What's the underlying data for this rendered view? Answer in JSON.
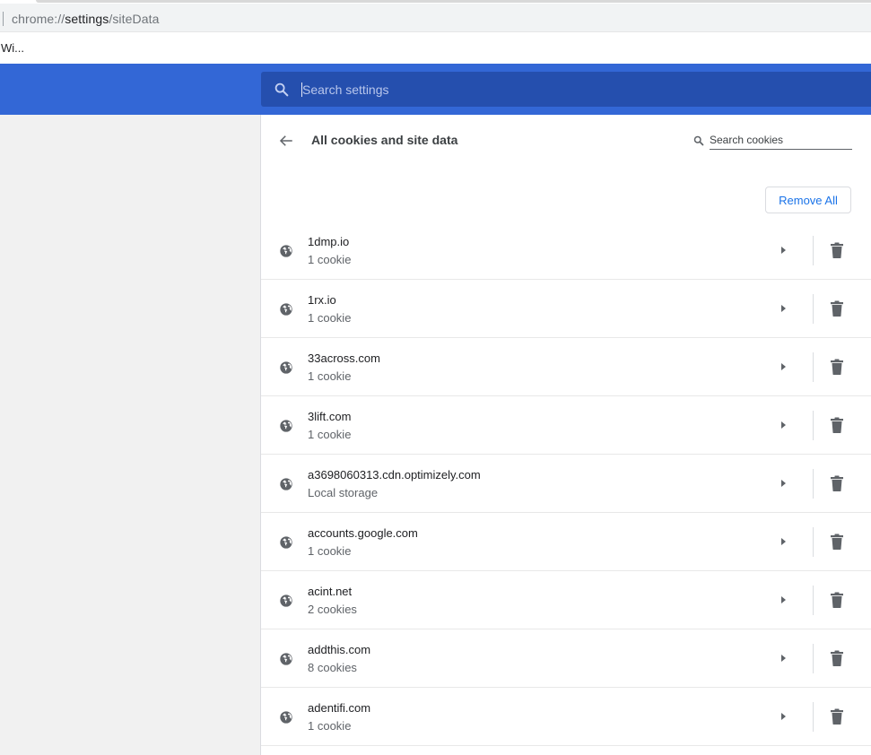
{
  "browser": {
    "url_scheme": "chrome://",
    "url_host": "settings",
    "url_path": "/siteData",
    "bookmark_label": "Wi..."
  },
  "header": {
    "search_placeholder": "Search settings",
    "color": "#3367d6"
  },
  "page": {
    "title": "All cookies and site data",
    "search_placeholder": "Search cookies",
    "remove_all_label": "Remove All"
  },
  "sites": [
    {
      "name": "1dmp.io",
      "detail": "1 cookie"
    },
    {
      "name": "1rx.io",
      "detail": "1 cookie"
    },
    {
      "name": "33across.com",
      "detail": "1 cookie"
    },
    {
      "name": "3lift.com",
      "detail": "1 cookie"
    },
    {
      "name": "a3698060313.cdn.optimizely.com",
      "detail": "Local storage"
    },
    {
      "name": "accounts.google.com",
      "detail": "1 cookie"
    },
    {
      "name": "acint.net",
      "detail": "2 cookies"
    },
    {
      "name": "addthis.com",
      "detail": "8 cookies"
    },
    {
      "name": "adentifi.com",
      "detail": "1 cookie"
    }
  ],
  "icons": {
    "search": "search-icon",
    "back": "back-arrow-icon",
    "site": "globe-icon",
    "expand": "chevron-right-icon",
    "delete": "trash-icon"
  }
}
